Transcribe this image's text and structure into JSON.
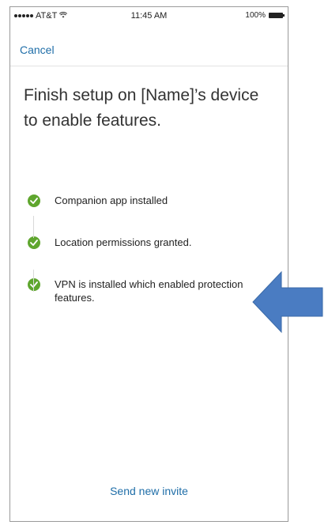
{
  "status_bar": {
    "carrier": "AT&T",
    "time": "11:45 AM",
    "battery": "100%"
  },
  "nav": {
    "cancel_label": "Cancel"
  },
  "headline": "Finish setup on [Name]’s device to enable features.",
  "steps": [
    {
      "label": "Companion app installed",
      "status": "complete"
    },
    {
      "label": "Location permissions granted.",
      "status": "complete"
    },
    {
      "label": "VPN is installed which enabled protection features.",
      "status": "complete"
    }
  ],
  "footer": {
    "send_invite_label": "Send new invite"
  },
  "colors": {
    "link": "#1f6ea8",
    "check": "#5fa62e",
    "annotation_arrow": "#4a7cc2"
  },
  "icons": {
    "step_status": "check-circle-icon",
    "annotation": "arrow-left-icon"
  }
}
